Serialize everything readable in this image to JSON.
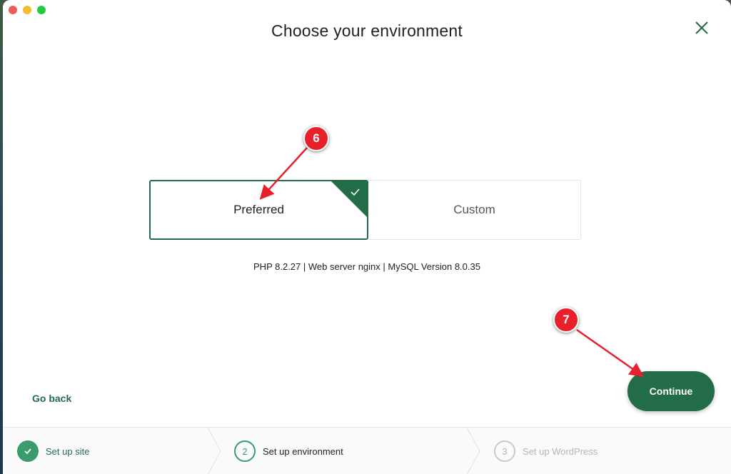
{
  "window": {
    "title": "Choose your environment"
  },
  "options": {
    "preferred_label": "Preferred",
    "custom_label": "Custom",
    "selected": "Preferred"
  },
  "environment_info": "PHP 8.2.27 | Web server nginx | MySQL Version 8.0.35",
  "footer": {
    "go_back_label": "Go back",
    "continue_label": "Continue"
  },
  "steps": [
    {
      "number": "✓",
      "label": "Set up site",
      "state": "completed"
    },
    {
      "number": "2",
      "label": "Set up environment",
      "state": "current"
    },
    {
      "number": "3",
      "label": "Set up WordPress",
      "state": "upcoming"
    }
  ],
  "annotations": [
    {
      "number": "6",
      "target": "Preferred"
    },
    {
      "number": "7",
      "target": "Continue"
    }
  ],
  "colors": {
    "accent": "#236c4a",
    "step_green": "#3a9c6b",
    "annotation_red": "#e8202a"
  }
}
